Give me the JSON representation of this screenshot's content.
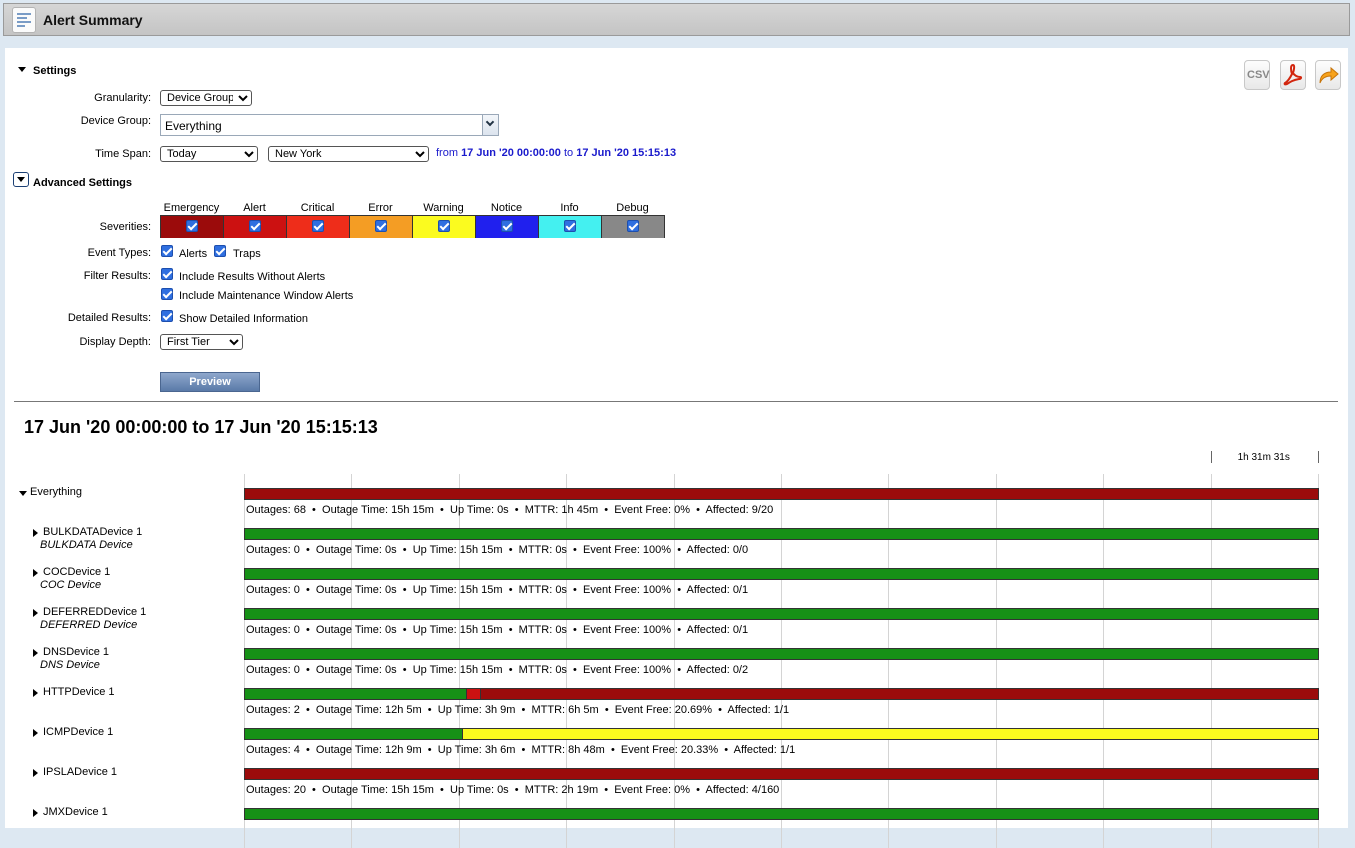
{
  "window": {
    "title": "Alert Summary"
  },
  "toolbar": {
    "csv_label": "CSV",
    "pdf_icon": "pdf-icon",
    "share_icon": "share-arrow-icon"
  },
  "settings": {
    "section_label": "Settings",
    "granularity": {
      "label": "Granularity:",
      "value": "Device Group"
    },
    "device_group": {
      "label": "Device Group:",
      "value": "Everything"
    },
    "time_span": {
      "label": "Time Span:",
      "value": "Today",
      "timezone": "New York",
      "from_word": "from",
      "from": "17 Jun '20 00:00:00",
      "to_word": "to",
      "to": "17 Jun '20 15:15:13"
    }
  },
  "advanced": {
    "section_label": "Advanced Settings",
    "severities_label": "Severities:",
    "severities": [
      {
        "name": "Emergency",
        "color": "#9b0b0b"
      },
      {
        "name": "Alert",
        "color": "#cc1111"
      },
      {
        "name": "Critical",
        "color": "#ee2d1a"
      },
      {
        "name": "Error",
        "color": "#f49d24"
      },
      {
        "name": "Warning",
        "color": "#fbfb1f"
      },
      {
        "name": "Notice",
        "color": "#2020ee"
      },
      {
        "name": "Info",
        "color": "#44f0f0"
      },
      {
        "name": "Debug",
        "color": "#888888"
      }
    ],
    "event_types_label": "Event Types:",
    "event_alerts": "Alerts",
    "event_traps": "Traps",
    "filter_label": "Filter Results:",
    "filter_without_alerts": "Include Results Without Alerts",
    "filter_maintenance": "Include Maintenance Window Alerts",
    "detailed_label": "Detailed Results:",
    "detailed_value": "Show Detailed Information",
    "depth_label": "Display Depth:",
    "depth_value": "First Tier",
    "preview_label": "Preview"
  },
  "report": {
    "range_title": "17 Jun '20 00:00:00 to 17 Jun '20 15:15:13",
    "scale_label": "1h 31m 31s",
    "colors": {
      "up": "#169116",
      "outage": "#9b0b0b",
      "alert": "#cc1111",
      "warning": "#fbfb1f"
    },
    "rows": [
      {
        "name": "Everything",
        "sub": "",
        "expanded": true,
        "segments": [
          {
            "color": "outage",
            "frac": 1.0
          }
        ],
        "stats": [
          "Outages: 68",
          "Outage Time: 15h 15m",
          "Up Time: 0s",
          "MTTR: 1h 45m",
          "Event Free: 0%",
          "Affected: 9/20"
        ]
      },
      {
        "name": "BULKDATADevice 1",
        "sub": "BULKDATA Device",
        "expanded": false,
        "segments": [
          {
            "color": "up",
            "frac": 1.0
          }
        ],
        "stats": [
          "Outages: 0",
          "Outage Time: 0s",
          "Up Time: 15h 15m",
          "MTTR: 0s",
          "Event Free: 100%",
          "Affected: 0/0"
        ]
      },
      {
        "name": "COCDevice 1",
        "sub": "COC Device",
        "expanded": false,
        "segments": [
          {
            "color": "up",
            "frac": 1.0
          }
        ],
        "stats": [
          "Outages: 0",
          "Outage Time: 0s",
          "Up Time: 15h 15m",
          "MTTR: 0s",
          "Event Free: 100%",
          "Affected: 0/1"
        ]
      },
      {
        "name": "DEFERREDDevice 1",
        "sub": "DEFERRED Device",
        "expanded": false,
        "segments": [
          {
            "color": "up",
            "frac": 1.0
          }
        ],
        "stats": [
          "Outages: 0",
          "Outage Time: 0s",
          "Up Time: 15h 15m",
          "MTTR: 0s",
          "Event Free: 100%",
          "Affected: 0/1"
        ]
      },
      {
        "name": "DNSDevice 1",
        "sub": "DNS Device",
        "expanded": false,
        "segments": [
          {
            "color": "up",
            "frac": 1.0
          }
        ],
        "stats": [
          "Outages: 0",
          "Outage Time: 0s",
          "Up Time: 15h 15m",
          "MTTR: 0s",
          "Event Free: 100%",
          "Affected: 0/2"
        ]
      },
      {
        "name": "HTTPDevice 1",
        "sub": "",
        "expanded": false,
        "segments": [
          {
            "color": "up",
            "frac": 0.207
          },
          {
            "color": "alert",
            "frac": 0.013
          },
          {
            "color": "outage",
            "frac": 0.78
          }
        ],
        "stats": [
          "Outages: 2",
          "Outage Time: 12h 5m",
          "Up Time: 3h 9m",
          "MTTR: 6h 5m",
          "Event Free: 20.69%",
          "Affected: 1/1"
        ]
      },
      {
        "name": "ICMPDevice 1",
        "sub": "",
        "expanded": false,
        "segments": [
          {
            "color": "up",
            "frac": 0.203
          },
          {
            "color": "warning",
            "frac": 0.797
          }
        ],
        "stats": [
          "Outages: 4",
          "Outage Time: 12h 9m",
          "Up Time: 3h 6m",
          "MTTR: 8h 48m",
          "Event Free: 20.33%",
          "Affected: 1/1"
        ]
      },
      {
        "name": "IPSLADevice 1",
        "sub": "",
        "expanded": false,
        "segments": [
          {
            "color": "outage",
            "frac": 1.0
          }
        ],
        "stats": [
          "Outages: 20",
          "Outage Time: 15h 15m",
          "Up Time: 0s",
          "MTTR: 2h 19m",
          "Event Free: 0%",
          "Affected: 4/160"
        ]
      },
      {
        "name": "JMXDevice 1",
        "sub": "",
        "expanded": false,
        "segments": [
          {
            "color": "up",
            "frac": 1.0
          }
        ],
        "stats": []
      }
    ]
  }
}
